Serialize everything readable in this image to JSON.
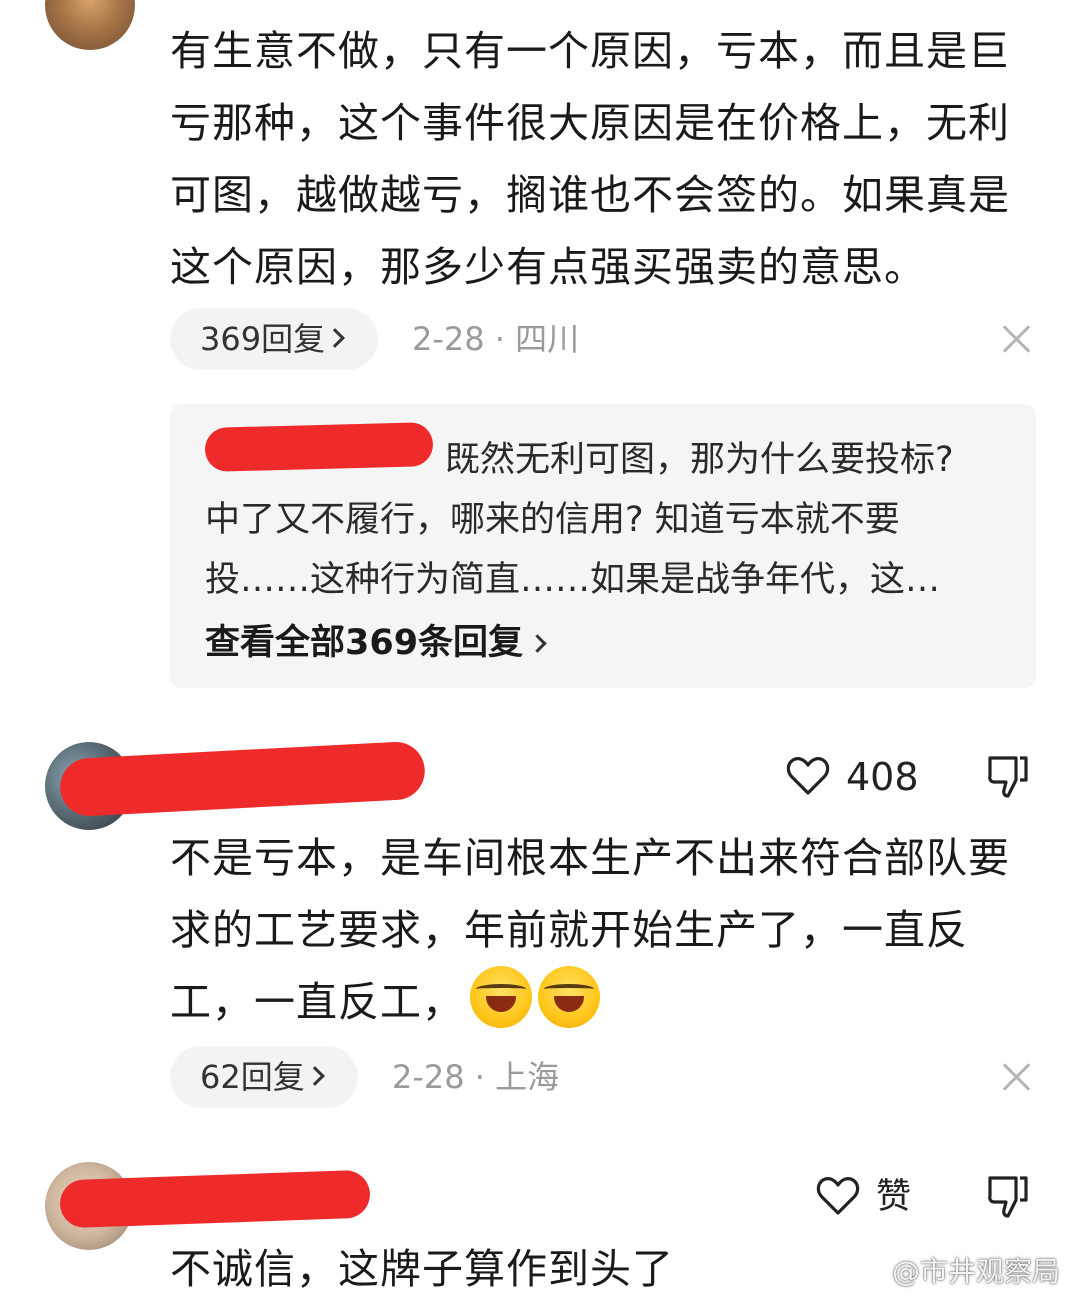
{
  "comment1": {
    "text": "有生意不做，只有一个原因，亏本，而且是巨亏那种，这个事件很大原因是在价格上，无利可图，越做越亏，搁谁也不会签的。如果真是这个原因，那多少有点强买强卖的意思。",
    "replies_label": "369回复",
    "meta": "2-28 · 四川",
    "reply_preview": {
      "line1": "既然无利可图，那为什么要投标?",
      "line2": "中了又不履行，哪来的信用? 知道亏本就不要",
      "line3": "投……这种行为简直……如果是战争年代，这…",
      "view_all": "查看全部369条回复"
    }
  },
  "comment2": {
    "likes": "408",
    "text": "不是亏本，是车间根本生产不出来符合部队要求的工艺要求，年前就开始生产了，一直反工，一直反工，",
    "emoji_icons": [
      "tears-of-joy-emoji",
      "tears-of-joy-emoji"
    ],
    "replies_label": "62回复",
    "meta": "2-28 · 上海"
  },
  "comment3": {
    "likes": "赞",
    "text": "不诚信，这牌子算作到头了"
  },
  "watermark": "@市井观察局",
  "colors": {
    "redaction": "#ef2a2a",
    "meta_gray": "#9a9a9a",
    "pill_bg": "#f3f3f3",
    "reply_box_bg": "#f5f5f5"
  }
}
